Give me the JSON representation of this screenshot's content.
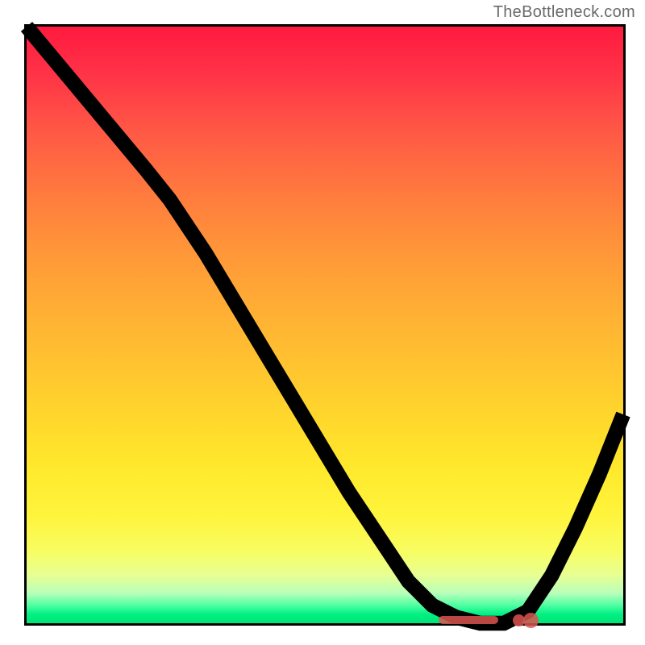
{
  "watermark": "TheBottleneck.com",
  "chart_data": {
    "type": "line",
    "title": "",
    "xlabel": "",
    "ylabel": "",
    "xlim": [
      0,
      100
    ],
    "ylim": [
      0,
      100
    ],
    "x": [
      0,
      5,
      10,
      15,
      20,
      24,
      30,
      36,
      42,
      48,
      54,
      60,
      64,
      68,
      72,
      76,
      80,
      84,
      88,
      92,
      96,
      100
    ],
    "values": [
      100,
      94,
      88,
      82,
      76,
      71,
      62,
      52,
      42,
      32,
      22,
      13,
      7,
      3,
      1,
      0,
      0,
      2,
      8,
      16,
      25,
      35
    ],
    "gradient_stops": [
      {
        "pos": 0,
        "color": "#ff1a3f"
      },
      {
        "pos": 50,
        "color": "#ffb030"
      },
      {
        "pos": 85,
        "color": "#fff73a"
      },
      {
        "pos": 100,
        "color": "#00e476"
      }
    ],
    "valley_markers": {
      "bar": {
        "x0": 69,
        "x1": 79,
        "y": 0.5
      },
      "dots": [
        {
          "x": 82.5,
          "y": 0.5,
          "r": 1.0
        },
        {
          "x": 84.5,
          "y": 0.5,
          "r": 1.3
        }
      ],
      "color": "#d9534f"
    }
  }
}
